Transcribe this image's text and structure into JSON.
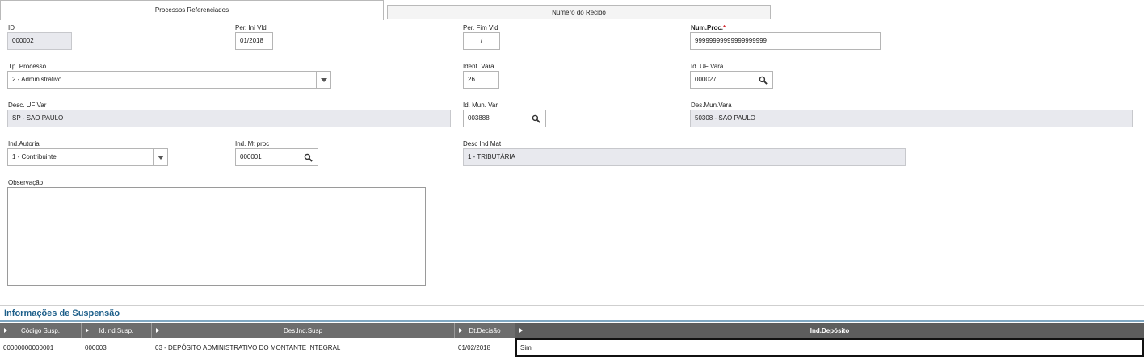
{
  "tabs": [
    {
      "label": "Processos Referenciados",
      "active": true
    },
    {
      "label": "Número do Recibo",
      "active": false
    }
  ],
  "form": {
    "id": {
      "label": "ID",
      "value": "000002"
    },
    "per_ini_vld": {
      "label": "Per. Ini Vld",
      "value": "01/2018"
    },
    "per_fim_vld": {
      "label": "Per. Fim Vld",
      "value": "/"
    },
    "num_proc": {
      "label": "Num.Proc.",
      "required_mark": "*",
      "value": "99999999999999999999"
    },
    "tp_processo": {
      "label": "Tp. Processo",
      "value": "2 - Administrativo"
    },
    "ident_vara": {
      "label": "Ident. Vara",
      "value": "26"
    },
    "id_uf_vara": {
      "label": "Id. UF Vara",
      "value": "000027"
    },
    "desc_uf_var": {
      "label": "Desc. UF Var",
      "value": "SP - SAO PAULO"
    },
    "id_mun_var": {
      "label": "Id. Mun. Var",
      "value": "003888"
    },
    "des_mun_vara": {
      "label": "Des.Mun.Vara",
      "value": "50308 - SAO PAULO"
    },
    "ind_autoria": {
      "label": "Ind.Autoria",
      "value": "1 - Contribuinte"
    },
    "ind_mt_proc": {
      "label": "Ind. Mt proc",
      "value": "000001"
    },
    "desc_ind_mat": {
      "label": "Desc Ind Mat",
      "value": "1 - TRIBUTÁRIA"
    },
    "observacao": {
      "label": "Observação",
      "value": ""
    }
  },
  "suspension": {
    "title": "Informações de Suspensão",
    "columns": [
      "Código Susp.",
      "Id.Ind.Susp.",
      "Des.Ind.Susp",
      "Dt.Decisão",
      "Ind.Depósito"
    ],
    "rows": [
      {
        "codigo": "00000000000001",
        "id_ind": "000003",
        "des_ind": "03 - DEPÓSITO ADMINISTRATIVO DO MONTANTE INTEGRAL",
        "dt_decisao": "01/02/2018",
        "ind_deposito": "Sim"
      }
    ]
  },
  "icons": {
    "search": "magnifier-icon",
    "dropdown": "chevron-down-icon",
    "sort": "triangle-right-icon"
  },
  "colors": {
    "accent": "#1d5f8a",
    "required": "#d2232a",
    "readonly_bg": "#e8e9ee",
    "grid_header": "#6d6d6d"
  }
}
